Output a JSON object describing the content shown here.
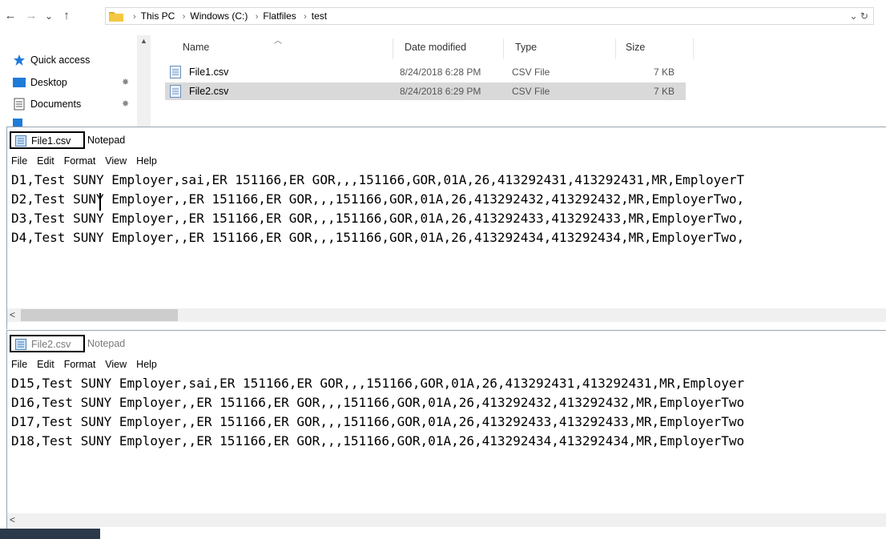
{
  "explorer": {
    "nav": {
      "back": "←",
      "forward": "→",
      "recent": "⌄",
      "up": "↑"
    },
    "breadcrumbs": [
      "This PC",
      "Windows (C:)",
      "Flatfiles",
      "test"
    ],
    "address_right": "⌄  ↻",
    "nav_pane": [
      {
        "label": "Quick access",
        "icon": "star-icon"
      },
      {
        "label": "Desktop",
        "icon": "desktop-icon"
      },
      {
        "label": "Documents",
        "icon": "documents-icon"
      }
    ],
    "columns": {
      "name": "Name",
      "date": "Date modified",
      "type": "Type",
      "size": "Size"
    },
    "files": [
      {
        "name": "File1.csv",
        "date": "8/24/2018 6:28 PM",
        "type": "CSV File",
        "size": "7 KB"
      },
      {
        "name": "File2.csv",
        "date": "8/24/2018 6:29 PM",
        "type": "CSV File",
        "size": "7 KB"
      }
    ]
  },
  "notepad1": {
    "file": "File1.csv",
    "app": "Notepad",
    "menu": [
      "File",
      "Edit",
      "Format",
      "View",
      "Help"
    ],
    "lines": [
      "D1,Test SUNY Employer,sai,ER 151166,ER GOR,,,151166,GOR,01A,26,413292431,413292431,MR,EmployerT",
      "D2,Test SUNY Employer,,ER 151166,ER GOR,,,151166,GOR,01A,26,413292432,413292432,MR,EmployerTwo,",
      "D3,Test SUNY Employer,,ER 151166,ER GOR,,,151166,GOR,01A,26,413292433,413292433,MR,EmployerTwo,",
      "D4,Test SUNY Employer,,ER 151166,ER GOR,,,151166,GOR,01A,26,413292434,413292434,MR,EmployerTwo,"
    ]
  },
  "notepad2": {
    "file": "File2.csv",
    "app": "Notepad",
    "menu": [
      "File",
      "Edit",
      "Format",
      "View",
      "Help"
    ],
    "lines": [
      "D15,Test SUNY Employer,sai,ER 151166,ER GOR,,,151166,GOR,01A,26,413292431,413292431,MR,Employer",
      "D16,Test SUNY Employer,,ER 151166,ER GOR,,,151166,GOR,01A,26,413292432,413292432,MR,EmployerTwo",
      "D17,Test SUNY Employer,,ER 151166,ER GOR,,,151166,GOR,01A,26,413292433,413292433,MR,EmployerTwo",
      "D18,Test SUNY Employer,,ER 151166,ER GOR,,,151166,GOR,01A,26,413292434,413292434,MR,EmployerTwo"
    ]
  },
  "scroll_left": "<",
  "colors": {
    "selection": "#d9d9d9",
    "folder": "#f3c842",
    "accent": "#0078d7"
  }
}
